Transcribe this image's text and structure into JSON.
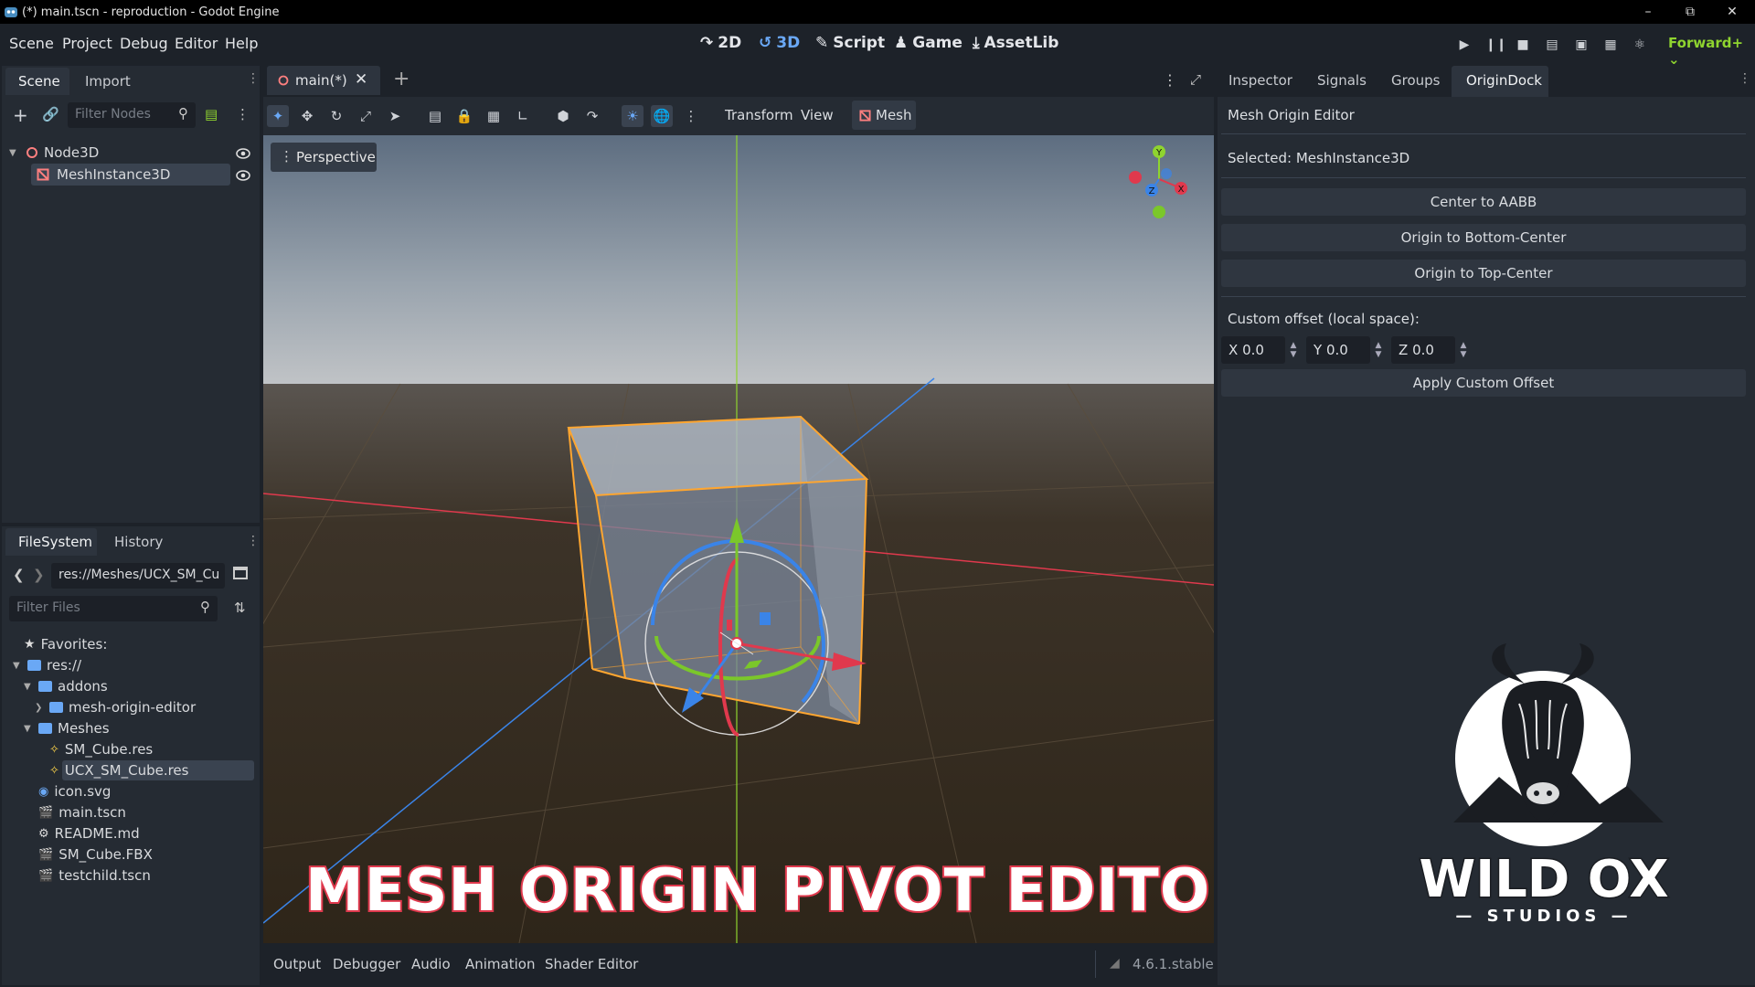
{
  "window": {
    "title": "(*) main.tscn - reproduction - Godot Engine",
    "min_icon": "minimize-icon",
    "max_icon": "maximize-icon",
    "close_icon": "close-icon"
  },
  "menu": [
    "Scene",
    "Project",
    "Debug",
    "Editor",
    "Help"
  ],
  "workspaces": [
    {
      "label": "2D",
      "icon": "2d-icon"
    },
    {
      "label": "3D",
      "icon": "3d-icon",
      "active": true
    },
    {
      "label": "Script",
      "icon": "script-icon"
    },
    {
      "label": "Game",
      "icon": "game-icon"
    },
    {
      "label": "AssetLib",
      "icon": "assetlib-icon"
    }
  ],
  "renderer": "Forward+",
  "scene_dock": {
    "tabs": [
      "Scene",
      "Import"
    ],
    "filter_placeholder": "Filter Nodes",
    "nodes": [
      {
        "name": "Node3D",
        "icon": "node3d-icon"
      },
      {
        "name": "MeshInstance3D",
        "icon": "meshinstance-icon",
        "selected": true
      }
    ]
  },
  "filesystem_dock": {
    "tabs": [
      "FileSystem",
      "History"
    ],
    "path": "res://Meshes/UCX_SM_Cu",
    "filter_placeholder": "Filter Files",
    "favorites_label": "Favorites:",
    "items": [
      {
        "label": "res://",
        "type": "folder",
        "indent": 0,
        "expanded": true
      },
      {
        "label": "addons",
        "type": "folder",
        "indent": 1,
        "expanded": true
      },
      {
        "label": "mesh-origin-editor",
        "type": "folder",
        "indent": 2,
        "expanded": false
      },
      {
        "label": "Meshes",
        "type": "folder",
        "indent": 1,
        "expanded": true
      },
      {
        "label": "SM_Cube.res",
        "type": "mesh",
        "indent": 2
      },
      {
        "label": "UCX_SM_Cube.res",
        "type": "mesh",
        "indent": 2,
        "selected": true
      },
      {
        "label": "icon.svg",
        "type": "svg",
        "indent": 1
      },
      {
        "label": "main.tscn",
        "type": "scene",
        "indent": 1
      },
      {
        "label": "README.md",
        "type": "md",
        "indent": 1
      },
      {
        "label": "SM_Cube.FBX",
        "type": "scene",
        "indent": 1
      },
      {
        "label": "testchild.tscn",
        "type": "scene",
        "indent": 1
      }
    ]
  },
  "editor_tabs": [
    {
      "label": "main(*)",
      "active": true
    }
  ],
  "viewport_toolbar": {
    "transform_label": "Transform",
    "view_label": "View",
    "mesh_label": "Mesh"
  },
  "viewport": {
    "perspective_label": "Perspective",
    "overlay_title": "MESH ORIGIN PIVOT EDITOR",
    "gizmo_labels": {
      "x": "X",
      "y": "Y",
      "z": "Z"
    }
  },
  "inspector_dock": {
    "tabs": [
      "Inspector",
      "Signals",
      "Groups",
      "OriginDock"
    ],
    "active_tab": "OriginDock",
    "title": "Mesh Origin Editor",
    "selected": "Selected: MeshInstance3D",
    "buttons": [
      "Center to AABB",
      "Origin to Bottom-Center",
      "Origin to Top-Center"
    ],
    "custom_offset_label": "Custom offset (local space):",
    "offsets": [
      {
        "axis": "X",
        "value": "0.0"
      },
      {
        "axis": "Y",
        "value": "0.0"
      },
      {
        "axis": "Z",
        "value": "0.0"
      }
    ],
    "apply_label": "Apply Custom Offset"
  },
  "bottom_panel": {
    "tabs": [
      "Output",
      "Debugger",
      "Audio",
      "Animation",
      "Shader Editor"
    ],
    "version": "4.6.1.stable"
  },
  "logo": {
    "name": "WILD OX",
    "sub": "STUDIOS"
  },
  "colors": {
    "accent": "#6aa8f5",
    "selection_orange": "#ffa630",
    "axis_x": "#e8384f",
    "axis_y": "#8fd42f",
    "axis_z": "#3d8ef2"
  }
}
